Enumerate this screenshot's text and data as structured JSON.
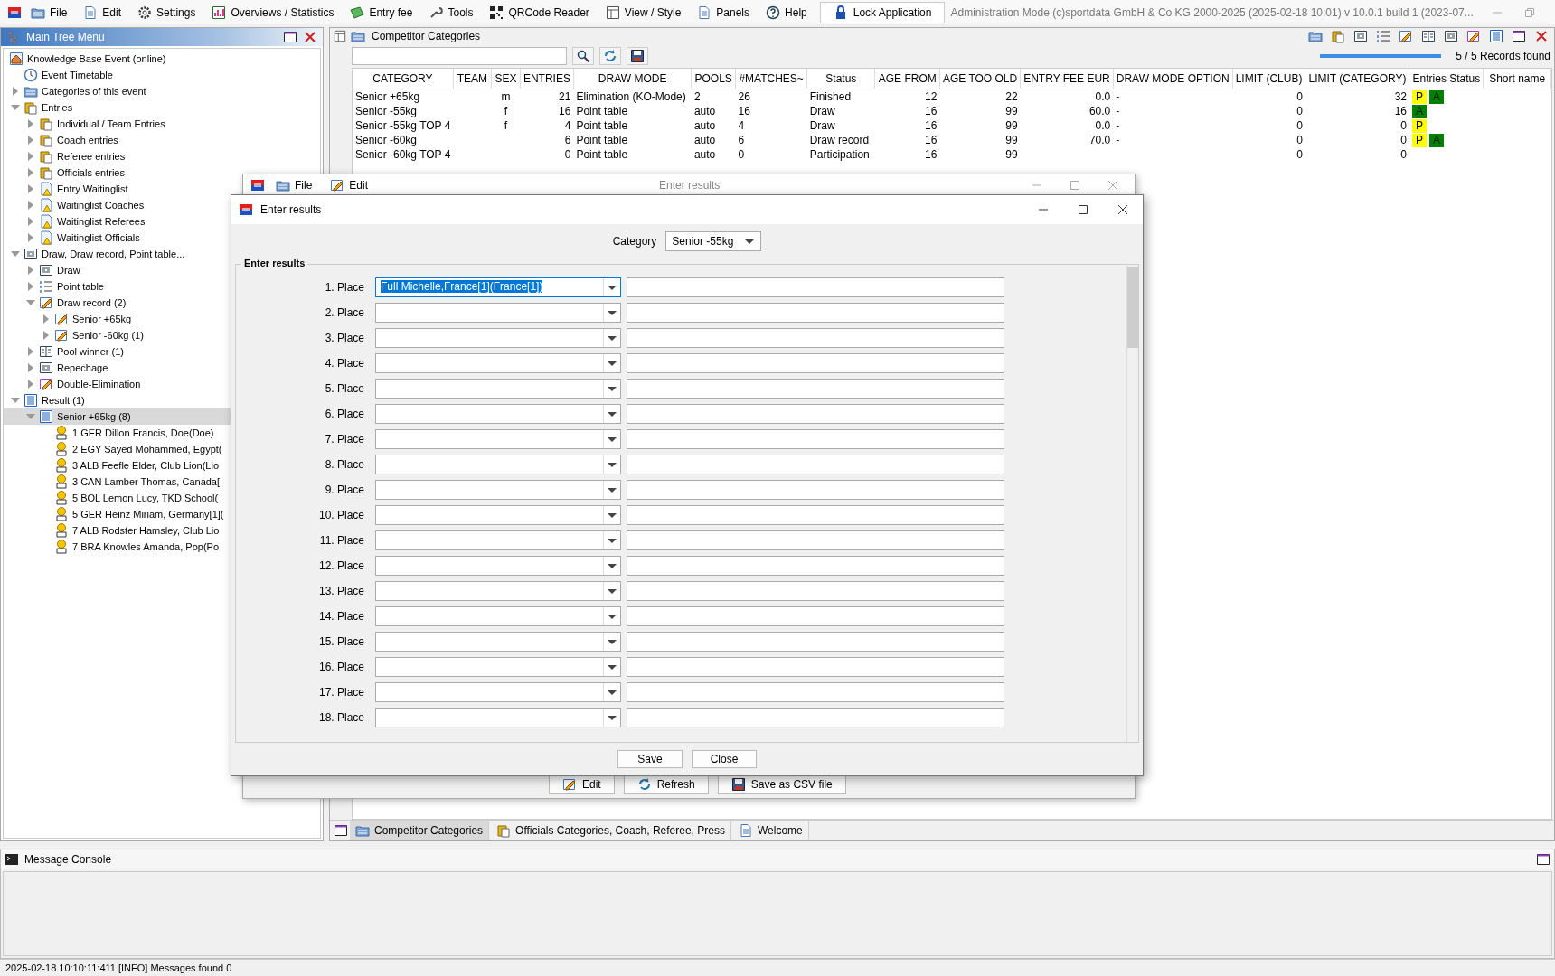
{
  "menu_bar": {
    "items": [
      {
        "label": "File"
      },
      {
        "label": "Edit"
      },
      {
        "label": "Settings"
      },
      {
        "label": "Overviews / Statistics"
      },
      {
        "label": "Entry fee"
      },
      {
        "label": "Tools"
      },
      {
        "label": "QRCode Reader"
      },
      {
        "label": "View / Style"
      },
      {
        "label": "Panels"
      },
      {
        "label": "Help"
      }
    ],
    "lock_button": "Lock Application",
    "info": "Administration Mode (c)sportdata GmbH & Co KG 2000-2025 (2025-02-18 10:01) v 10.0.1 build 1 (2023-07..."
  },
  "tree_panel": {
    "title": "Main Tree Menu",
    "items": [
      {
        "label": "Knowledge Base Event (online)",
        "kind": "home",
        "selected": false,
        "children": [
          {
            "label": "Event Timetable",
            "kind": "clock",
            "selected": false
          },
          {
            "label": "Categories of this event",
            "kind": "categories",
            "selected": false,
            "expanded": false
          },
          {
            "label": "Entries",
            "kind": "clipboard",
            "selected": false,
            "expanded": true,
            "children": [
              {
                "label": "Individual / Team Entries",
                "kind": "clipboard",
                "selected": false,
                "expanded": false
              },
              {
                "label": "Coach entries",
                "kind": "clipboard",
                "selected": false,
                "expanded": false
              },
              {
                "label": "Referee entries",
                "kind": "clipboard",
                "selected": false,
                "expanded": false
              },
              {
                "label": "Officials entries",
                "kind": "clipboard",
                "selected": false,
                "expanded": false
              },
              {
                "label": "Entry Waitinglist",
                "kind": "waiting",
                "selected": false,
                "expanded": false
              },
              {
                "label": "Waitinglist Coaches",
                "kind": "waiting",
                "selected": false,
                "expanded": false
              },
              {
                "label": "Waitinglist Referees",
                "kind": "waiting",
                "selected": false,
                "expanded": false
              },
              {
                "label": "Waitinglist Officials",
                "kind": "waiting",
                "selected": false,
                "expanded": false
              }
            ]
          },
          {
            "label": "Draw, Draw record, Point table...",
            "kind": "draw",
            "selected": false,
            "expanded": true,
            "children": [
              {
                "label": "Draw",
                "kind": "draw",
                "selected": false,
                "expanded": false
              },
              {
                "label": "Point table",
                "kind": "numlist",
                "selected": false,
                "expanded": false
              },
              {
                "label": "Draw record (2)",
                "kind": "pencildoc",
                "selected": false,
                "expanded": true,
                "children": [
                  {
                    "label": "Senior +65kg",
                    "kind": "pencildoc",
                    "selected": false,
                    "expanded": false
                  },
                  {
                    "label": "Senior -60kg (1)",
                    "kind": "pencildoc",
                    "selected": false,
                    "expanded": false
                  }
                ]
              },
              {
                "label": "Pool winner (1)",
                "kind": "columns",
                "selected": false,
                "expanded": false
              },
              {
                "label": "Repechage",
                "kind": "repechage",
                "selected": false,
                "expanded": false
              },
              {
                "label": "Double-Elimination",
                "kind": "doubleelim",
                "selected": false,
                "expanded": false
              }
            ]
          },
          {
            "label": "Result (1)",
            "kind": "result",
            "selected": false,
            "expanded": true,
            "children": [
              {
                "label": "Senior +65kg (8)",
                "kind": "result",
                "selected": true,
                "expanded": true,
                "children": [
                  {
                    "label": "1 GER Dillon Francis, Doe(Doe)",
                    "kind": "medal",
                    "selected": false
                  },
                  {
                    "label": "2 EGY Sayed Mohammed, Egypt(",
                    "kind": "medal",
                    "selected": false
                  },
                  {
                    "label": "3 ALB Feefle Elder, Club Lion(Lio",
                    "kind": "medal",
                    "selected": false
                  },
                  {
                    "label": "3 CAN Lamber Thomas, Canada[",
                    "kind": "medal",
                    "selected": false
                  },
                  {
                    "label": "5 BOL Lemon Lucy, TKD School(",
                    "kind": "medal",
                    "selected": false
                  },
                  {
                    "label": "5 GER Heinz Miriam, Germany[1](",
                    "kind": "medal",
                    "selected": false
                  },
                  {
                    "label": "7 ALB Rodster Hamsley, Club Lio",
                    "kind": "medal",
                    "selected": false
                  },
                  {
                    "label": "7 BRA Knowles Amanda, Pop(Po",
                    "kind": "medal",
                    "selected": false
                  }
                ]
              }
            ]
          }
        ]
      }
    ]
  },
  "main_panel": {
    "title": "Competitor Categories",
    "progress": {
      "level": 1
    },
    "records": "5 / 5 Records found",
    "table": {
      "columns": [
        "CATEGORY",
        "TEAM",
        "SEX",
        "ENTRIES",
        "DRAW MODE",
        "POOLS",
        "#MATCHES~",
        "Status",
        "AGE FROM",
        "AGE TOO OLD",
        "ENTRY FEE EUR",
        "DRAW MODE OPTION",
        "LIMIT (CLUB)",
        "LIMIT (CATEGORY)",
        "Entries Status",
        "Short name"
      ],
      "rows": [
        {
          "category": "Senior +65kg",
          "sex": "m",
          "entries": "21",
          "draw_mode": "Elimination (KO-Mode)",
          "pools": "2",
          "matches": "26",
          "status": "Finished",
          "age_from": "12",
          "age_too_old": "22",
          "entry_fee": "0.0",
          "draw_mode_option": "-",
          "limit_club": "0",
          "limit_category": "32",
          "entries_status": [
            {
              "label": "P",
              "color": "#ffff00"
            },
            {
              "label": "A",
              "color": "#008000"
            }
          ]
        },
        {
          "category": "Senior -55kg",
          "sex": "f",
          "entries": "16",
          "draw_mode": "Point table",
          "pools": "auto",
          "matches": "16",
          "status": "Draw",
          "age_from": "16",
          "age_too_old": "99",
          "entry_fee": "60.0",
          "draw_mode_option": "-",
          "limit_club": "0",
          "limit_category": "16",
          "entries_status": [
            {
              "label": "A",
              "color": "#008000"
            }
          ]
        },
        {
          "category": "Senior -55kg TOP 4",
          "sex": "f",
          "entries": "4",
          "draw_mode": "Point table",
          "pools": "auto",
          "matches": "4",
          "status": "Draw",
          "age_from": "16",
          "age_too_old": "99",
          "entry_fee": "0.0",
          "draw_mode_option": "-",
          "limit_club": "0",
          "limit_category": "0",
          "entries_status": [
            {
              "label": "P",
              "color": "#ffff00"
            }
          ]
        },
        {
          "category": "Senior -60kg",
          "entries": "6",
          "draw_mode": "Point table",
          "pools": "auto",
          "matches": "6",
          "status": "Draw record",
          "age_from": "16",
          "age_too_old": "99",
          "entry_fee": "70.0",
          "draw_mode_option": "-",
          "limit_club": "0",
          "limit_category": "0",
          "entries_status": [
            {
              "label": "P",
              "color": "#ffff00"
            },
            {
              "label": "A",
              "color": "#008000"
            }
          ]
        },
        {
          "category": "Senior -60kg TOP 4",
          "entries": "0",
          "draw_mode": "Point table",
          "pools": "auto",
          "matches": "0",
          "status": "Participation",
          "age_from": "16",
          "age_too_old": "99",
          "limit_club": "0",
          "limit_category": "0"
        }
      ]
    },
    "tabs": [
      {
        "label": "Competitor Categories",
        "selected": true
      },
      {
        "label": "Officials Categories, Coach, Referee, Press",
        "selected": false
      },
      {
        "label": "Welcome",
        "selected": false
      }
    ]
  },
  "back_window": {
    "title": "Enter results",
    "menu": [
      "File",
      "Edit"
    ],
    "buttons": [
      "Edit",
      "Refresh",
      "Save as CSV file"
    ]
  },
  "dialog": {
    "title": "Enter results",
    "category_label": "Category",
    "category": "Senior -55kg",
    "group_title": "Enter results",
    "places": [
      {
        "label": "1. Place",
        "value": "Full Michelle,France[1](France[1])",
        "highlighted": true
      },
      {
        "label": "2. Place",
        "highlighted": false
      },
      {
        "label": "3. Place",
        "highlighted": false
      },
      {
        "label": "4. Place",
        "highlighted": false
      },
      {
        "label": "5. Place",
        "highlighted": false
      },
      {
        "label": "6. Place",
        "highlighted": false
      },
      {
        "label": "7. Place",
        "highlighted": false
      },
      {
        "label": "8. Place",
        "highlighted": false
      },
      {
        "label": "9. Place",
        "highlighted": false
      },
      {
        "label": "10. Place",
        "highlighted": false
      },
      {
        "label": "11. Place",
        "highlighted": false
      },
      {
        "label": "12. Place",
        "highlighted": false
      },
      {
        "label": "13. Place",
        "highlighted": false
      },
      {
        "label": "14. Place",
        "highlighted": false
      },
      {
        "label": "15. Place",
        "highlighted": false
      },
      {
        "label": "16. Place",
        "highlighted": false
      },
      {
        "label": "17. Place",
        "highlighted": false
      },
      {
        "label": "18. Place",
        "highlighted": false
      }
    ],
    "buttons": [
      "Save",
      "Close"
    ]
  },
  "console": {
    "title": "Message Console"
  },
  "status_bar": "2025-02-18 10:10:11:411 [INFO] Messages found 0"
}
